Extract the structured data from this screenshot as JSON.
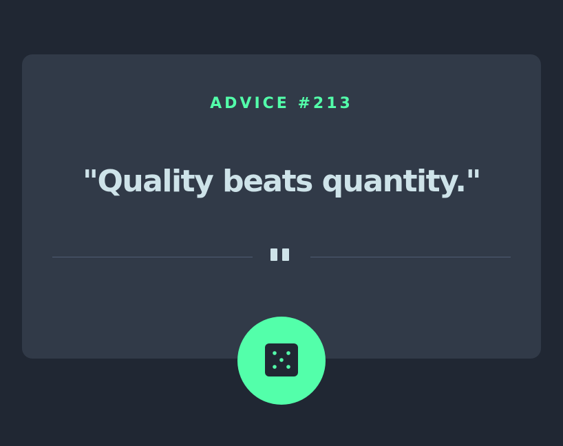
{
  "advice": {
    "label": "ADVICE #213",
    "text": "\"Quality beats quantity.\""
  },
  "icons": {
    "divider": "pause-icon",
    "button": "dice-icon"
  },
  "colors": {
    "background": "#202733",
    "card": "#313A48",
    "accent": "#53FFAA",
    "text": "#CEE3E9",
    "divider": "#4F5D74"
  }
}
